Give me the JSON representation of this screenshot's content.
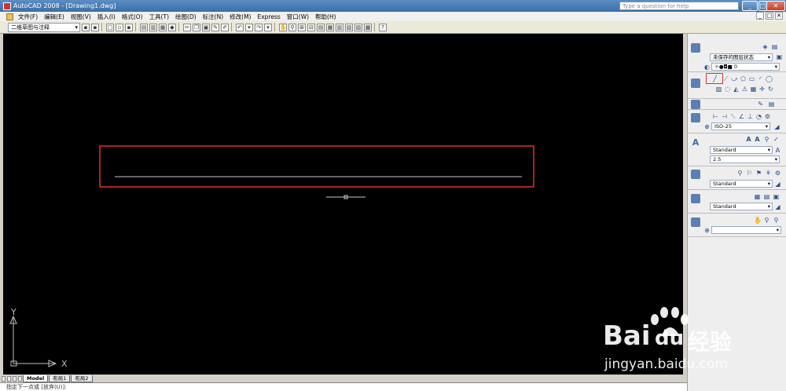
{
  "window": {
    "title": "AutoCAD 2008 - [Drawing1.dwg]",
    "ask_placeholder": "Type a question for help",
    "controls": [
      "_",
      "□",
      "✕"
    ]
  },
  "menu": {
    "items": [
      "文件(F)",
      "编辑(E)",
      "视图(V)",
      "插入(I)",
      "格式(O)",
      "工具(T)",
      "绘图(D)",
      "标注(N)",
      "修改(M)",
      "Express",
      "窗口(W)",
      "帮助(H)"
    ],
    "doc_controls": [
      "_",
      "□",
      "✕"
    ]
  },
  "toolbar": {
    "workspace": "二维草图与注释"
  },
  "canvas": {
    "ucs_x": "X",
    "ucs_y": "Y"
  },
  "tabs": {
    "model": "Model",
    "layout1": "布局1",
    "layout2": "布局2"
  },
  "command_line": {
    "text": "指定下一点或 [放弃(U)]:"
  },
  "dashboard": {
    "layer_state": "未保存的图层状态",
    "current_layer": "0",
    "dim_style": "ISO-25",
    "text_style": "Standard",
    "text_height": "2.5",
    "mleader_style": "Standard",
    "table_style": "Standard"
  },
  "watermark": {
    "brand": "Bai",
    "brand2": "du",
    "cn": "经验",
    "url": "jingyan.baidu.com"
  },
  "colors": {
    "canvas_bg": "#000000",
    "highlight": "#e03030",
    "line": "#c8c8c8"
  }
}
